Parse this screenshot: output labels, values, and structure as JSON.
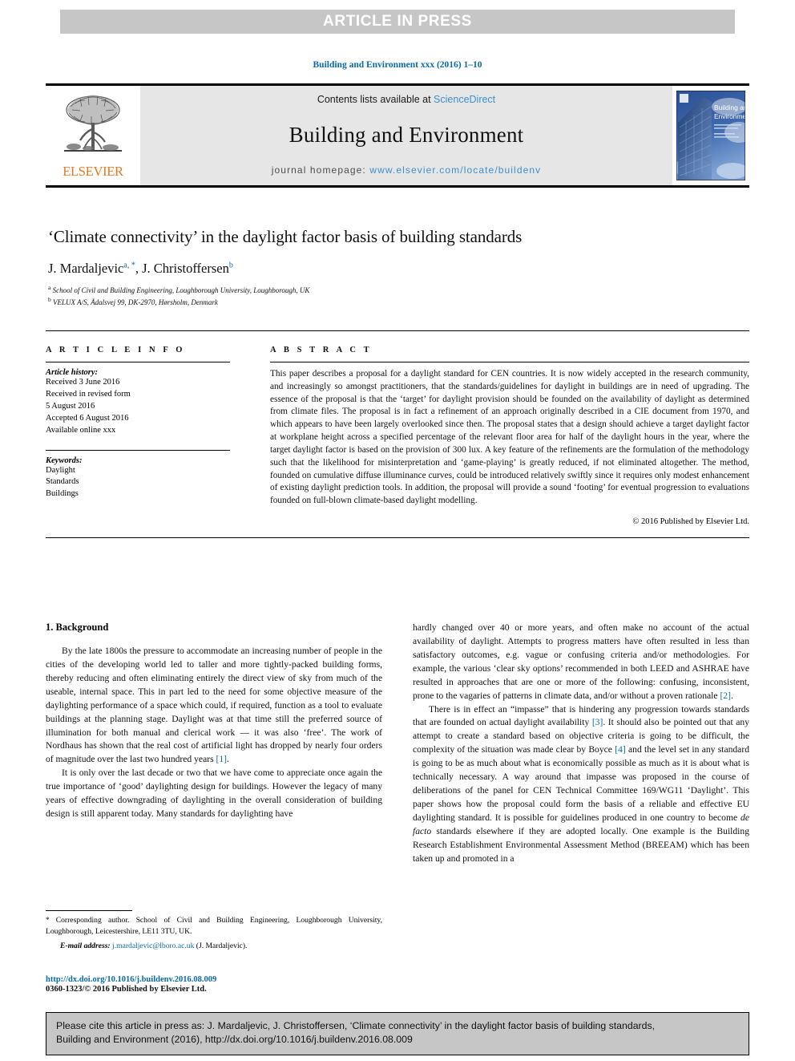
{
  "banner": {
    "text": "ARTICLE IN PRESS"
  },
  "journal_ref": "Building and Environment xxx (2016) 1–10",
  "masthead": {
    "elsevier_word": "ELSEVIER",
    "contents_prefix": "Contents lists available at ",
    "sciencedirect": "ScienceDirect",
    "journal_title": "Building and Environment",
    "homepage_prefix": "journal homepage: ",
    "homepage_url": "www.elsevier.com/locate/buildenv",
    "cover_title_line1": "Building and",
    "cover_title_line2": "Environment"
  },
  "article": {
    "title": "‘Climate connectivity’ in the daylight factor basis of building standards",
    "authors_text": "J. Mardaljevic",
    "author1_sup": "a, *",
    "author2_text": ", J. Christoffersen",
    "author2_sup": "b",
    "affiliation_a_sup": "a",
    "affiliation_a": " School of Civil and Building Engineering, Loughborough University, Loughborough, UK",
    "affiliation_b_sup": "b",
    "affiliation_b": " VELUX A/S, Ådalsvej 99, DK-2970, Hørsholm, Denmark"
  },
  "info": {
    "heading": "A R T I C L E   I N F O",
    "history_label": "Article history:",
    "history": [
      "Received 3 June 2016",
      "Received in revised form",
      "5 August 2016",
      "Accepted 6 August 2016",
      "Available online xxx"
    ],
    "keywords_label": "Keywords:",
    "keywords": [
      "Daylight",
      "Standards",
      "Buildings"
    ]
  },
  "abstract": {
    "heading": "A B S T R A C T",
    "body": "This paper describes a proposal for a daylight standard for CEN countries. It is now widely accepted in the research community, and increasingly so amongst practitioners, that the standards/guidelines for daylight in buildings are in need of upgrading. The essence of the proposal is that the ‘target’ for daylight provision should be founded on the availability of daylight as determined from climate files. The proposal is in fact a refinement of an approach originally described in a CIE document from 1970, and which appears to have been largely overlooked since then. The proposal states that a design should achieve a target daylight factor at workplane height across a specified percentage of the relevant floor area for half of the daylight hours in the year, where the target daylight factor is based on the provision of 300 lux. A key feature of the refinements are the formulation of the methodology such that the likelihood for misinterpretation and ‘game-playing’ is greatly reduced, if not eliminated altogether. The method, founded on cumulative diffuse illuminance curves, could be introduced relatively swiftly since it requires only modest enhancement of existing daylight prediction tools. In addition, the proposal will provide a sound ‘footing’ for eventual progression to evaluations founded on full-blown climate-based daylight modelling.",
    "copyright": "© 2016 Published by Elsevier Ltd."
  },
  "body": {
    "section1_title": "1. Background",
    "left_para1_a": "By the late 1800s the pressure to accommodate an increasing number of people in the cities of the developing world led to taller and more tightly-packed building forms, thereby reducing and often eliminating entirely the direct view of sky from much of the useable, internal space. This in part led to the need for some objective measure of the daylighting performance of a space which could, if required, function as a tool to evaluate buildings at the planning stage. Daylight was at that time still the preferred source of illumination for both manual and clerical work — it was also ‘free’. The work of Nordhaus has shown that the real cost of artificial light has dropped by nearly four orders of magnitude over the last two hundred years ",
    "left_para1_cite": "[1]",
    "left_para1_b": ".",
    "left_para2": "It is only over the last decade or two that we have come to appreciate once again the true importance of ‘good’ daylighting design for buildings. However the legacy of many years of effective downgrading of daylighting in the overall consideration of building design is still apparent today. Many standards for daylighting have",
    "right_para1_a": "hardly changed over 40 or more years, and often make no account of the actual availability of daylight. Attempts to progress matters have often resulted in less than satisfactory outcomes, e.g. vague or confusing criteria and/or methodologies. For example, the various ‘clear sky options’ recommended in both LEED and ASHRAE have resulted in approaches that are one or more of the following: confusing, inconsistent, prone to the vagaries of patterns in climate data, and/or without a proven rationale ",
    "right_para1_cite": "[2]",
    "right_para1_b": ".",
    "right_para2_a": "There is in effect an “impasse” that is hindering any progression towards standards that are founded on actual daylight availability ",
    "right_para2_cite1": "[3]",
    "right_para2_b": ". It should also be pointed out that any attempt to create a standard based on objective criteria is going to be difficult, the complexity of the situation was made clear by Boyce ",
    "right_para2_cite2": "[4]",
    "right_para2_c": " and the level set in any standard is going to be as much about what is economically possible as much as it is about what is technically necessary. A way around that impasse was proposed in the course of deliberations of the panel for CEN Technical Committee 169/WG11 ‘Daylight’. This paper shows how the proposal could form the basis of a reliable and effective EU daylighting standard. It is possible for guidelines produced in one country to become ",
    "right_para2_italic": "de facto",
    "right_para2_d": " standards elsewhere if they are adopted locally. One example is the Building Research Establishment Environmental Assessment Method (BREEAM) which has been taken up and promoted in a"
  },
  "footnote": {
    "star": "*",
    "corresponding": " Corresponding author. School of Civil and Building Engineering, Loughborough University, Loughborough, Leicestershire, LE11 3TU, UK.",
    "email_label": "E-mail address:",
    "email": "j.mardaljevic@lboro.ac.uk",
    "email_suffix": " (J. Mardaljevic)."
  },
  "doi": {
    "url": "http://dx.doi.org/10.1016/j.buildenv.2016.08.009",
    "issn": "0360-1323/© 2016 Published by Elsevier Ltd."
  },
  "cite_box": {
    "line1": "Please cite this article in press as: J. Mardaljevic, J. Christoffersen, ‘Climate connectivity’ in the daylight factor basis of building standards,",
    "line2": "Building and Environment (2016), http://dx.doi.org/10.1016/j.buildenv.2016.08.009"
  },
  "colors": {
    "link_blue": "#0a6ba8",
    "sd_blue": "#3c8fce",
    "elsevier_orange": "#e87722",
    "banner_gray": "#c6c6c6",
    "masthead_gray": "#e6e6e6"
  }
}
